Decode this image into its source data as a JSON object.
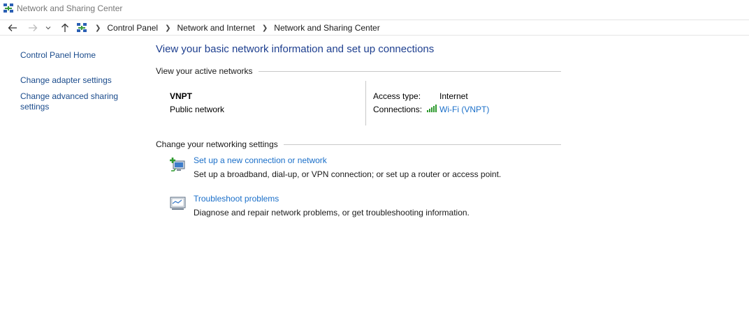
{
  "window": {
    "title": "Network and Sharing Center",
    "icon": "network-center-icon"
  },
  "address_bar": {
    "back_icon": "arrow-left-icon",
    "forward_icon": "arrow-right-icon",
    "recent_icon": "chevron-down-icon",
    "up_icon": "arrow-up-icon",
    "breadcrumbs": [
      "Control Panel",
      "Network and Internet",
      "Network and Sharing Center"
    ]
  },
  "left_pane": {
    "home": "Control Panel Home",
    "adapter": "Change adapter settings",
    "advanced": "Change advanced sharing settings"
  },
  "main": {
    "heading": "View your basic network information and set up connections",
    "active_networks_label": "View your active networks",
    "network": {
      "name": "VNPT",
      "type": "Public network",
      "access_type_label": "Access type:",
      "access_type_value": "Internet",
      "connections_label": "Connections:",
      "connection_link": "Wi-Fi (VNPT)",
      "connection_icon": "wifi-signal-icon"
    },
    "change_settings_label": "Change your networking settings",
    "tasks": [
      {
        "link": "Set up a new connection or network",
        "desc": "Set up a broadband, dial-up, or VPN connection; or set up a router or access point.",
        "icon": "new-connection-icon"
      },
      {
        "link": "Troubleshoot problems",
        "desc": "Diagnose and repair network problems, or get troubleshooting information.",
        "icon": "troubleshoot-icon"
      }
    ]
  },
  "colors": {
    "link": "#1a6fc9",
    "heading": "#1e3f8f",
    "nav_link": "#1a4b8c"
  }
}
